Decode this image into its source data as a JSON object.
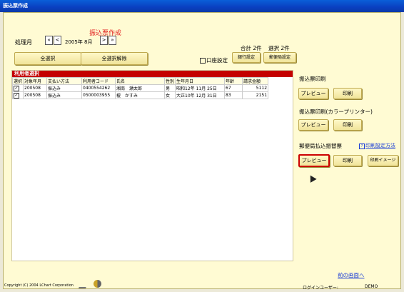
{
  "window": {
    "title": "振込票作成"
  },
  "header": {
    "title": "振込票作成"
  },
  "period": {
    "label": "処理月",
    "value": "2005年 8月",
    "first": "«",
    "prev": "<",
    "next": ">",
    "last": "»"
  },
  "summary": {
    "total": "合計 2件",
    "selected": "選択 2件"
  },
  "buttons": {
    "select_all": "全選択",
    "deselect_all": "全選択解除",
    "account_setting_label": "口座設定",
    "bank_setting": "銀行設定",
    "post_setting": "郵便局設定"
  },
  "table": {
    "title": "利用者選択",
    "columns": [
      "選択",
      "対象年月",
      "支払い方法",
      "利用者コード",
      "氏名",
      "性別",
      "生年月日",
      "年齢",
      "請求金額"
    ],
    "rows": [
      {
        "checked": "✓",
        "ym": "200508",
        "method": "振込み",
        "code": "0400554262",
        "name": "湘南　瀬太郎",
        "sex": "男",
        "birth": "昭和12年 11月 25日",
        "age": "67",
        "amount": "5112"
      },
      {
        "checked": "✓",
        "ym": "200508",
        "method": "振込み",
        "code": "0500003955",
        "name": "榎　かすみ",
        "sex": "女",
        "birth": "大正10年 12月 31日",
        "age": "83",
        "amount": "2151"
      }
    ]
  },
  "side": {
    "section1": {
      "label": "振込票印刷",
      "preview": "プレビュー",
      "print": "印刷"
    },
    "section2": {
      "label": "振込票印刷(カラープリンター)",
      "preview": "プレビュー",
      "print": "印刷"
    },
    "section3": {
      "label": "郵便局払込振替票",
      "help": "印刷設定方法",
      "preview": "プレビュー",
      "print": "印刷",
      "print_image": "印刷イメージ"
    }
  },
  "footer": {
    "back": "前の画面へ",
    "copyright": "Copyright (C) 2004 LChart Corporation",
    "login_label": "ログインユーザー:",
    "login_user": "DEMO"
  }
}
